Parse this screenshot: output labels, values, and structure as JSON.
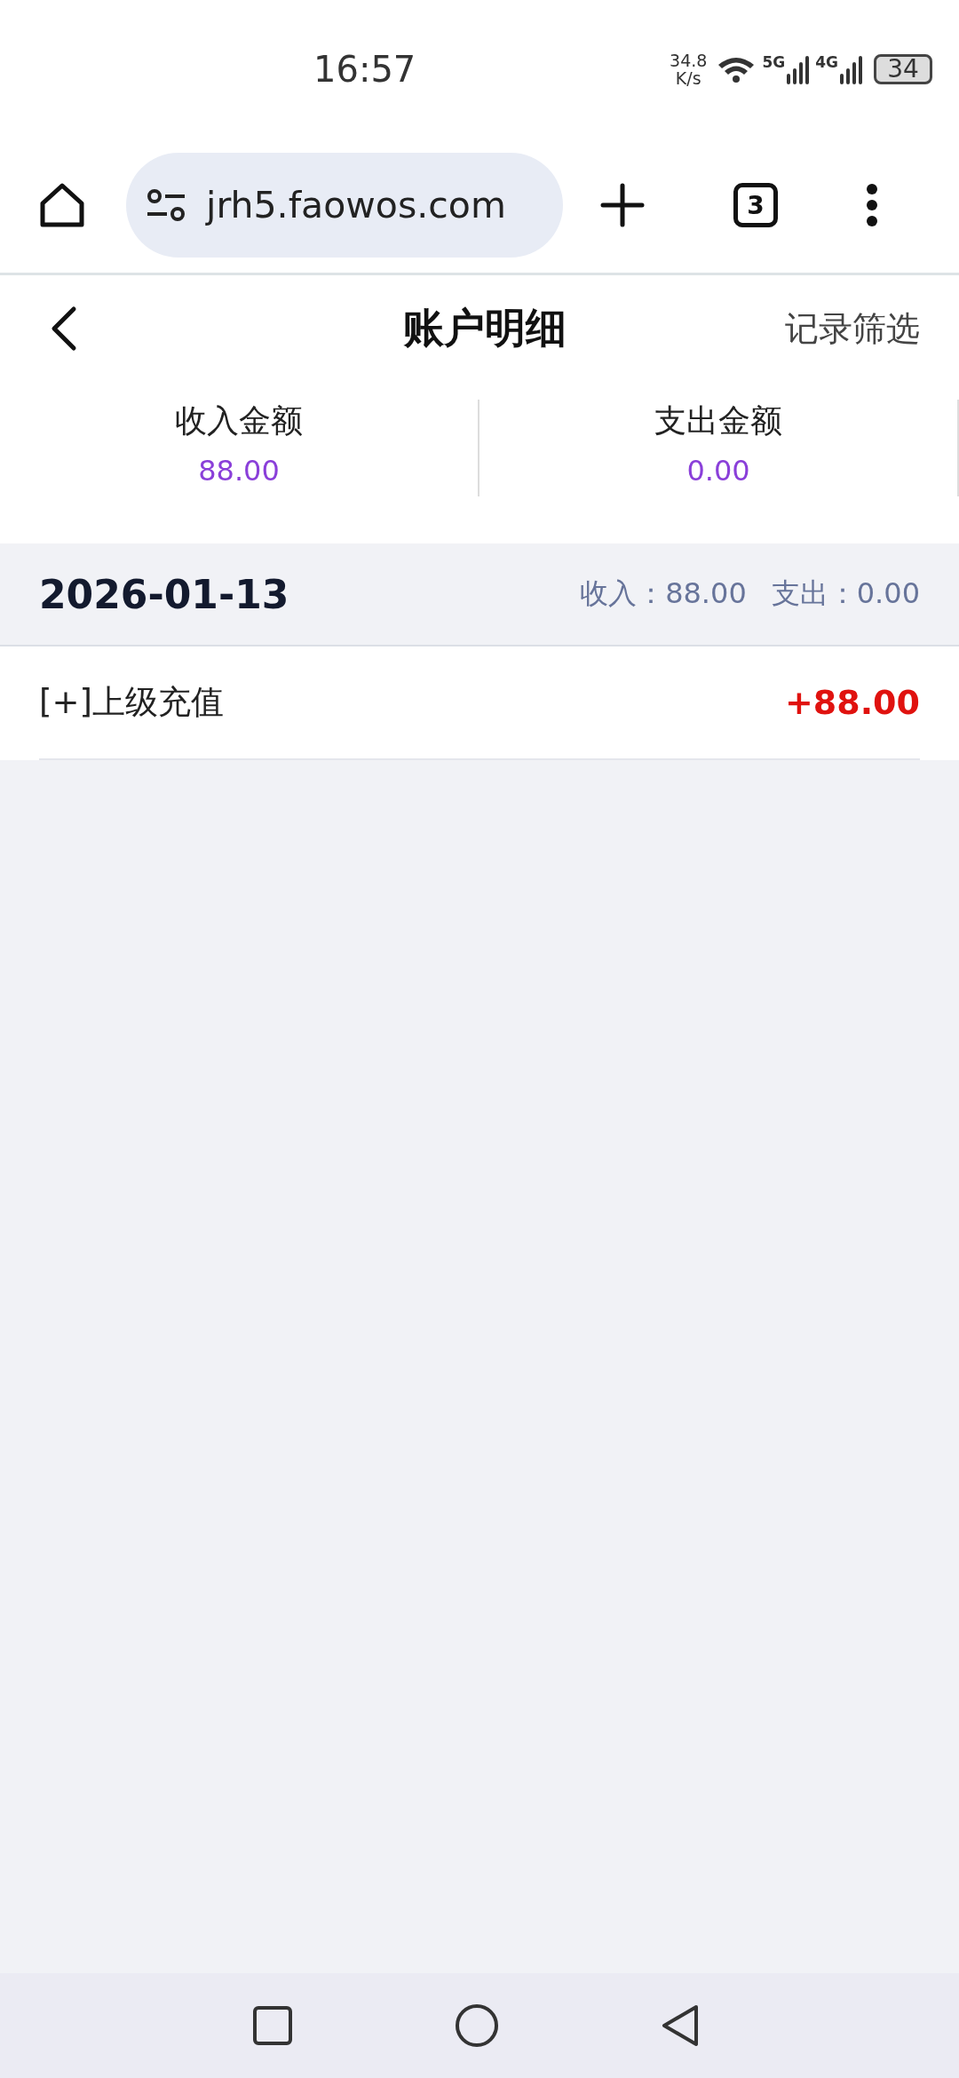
{
  "status_bar": {
    "time": "16:57",
    "net_speed_value": "34.8",
    "net_speed_unit": "K/s",
    "network_1": "5G",
    "network_2": "4G",
    "battery": "34"
  },
  "browser": {
    "url": "jrh5.faowos.com",
    "tab_count": "3"
  },
  "header": {
    "title": "账户明细",
    "action": "记录筛选"
  },
  "summary": [
    {
      "label": "收入金额",
      "value": "88.00"
    },
    {
      "label": "支出金额",
      "value": "0.00"
    }
  ],
  "groups": [
    {
      "date": "2026-01-13",
      "income": "收入：88.00",
      "expense": "支出：0.00",
      "records": [
        {
          "title": "[+]上级充值",
          "amount": "+88.00",
          "kind": "income"
        }
      ]
    }
  ]
}
